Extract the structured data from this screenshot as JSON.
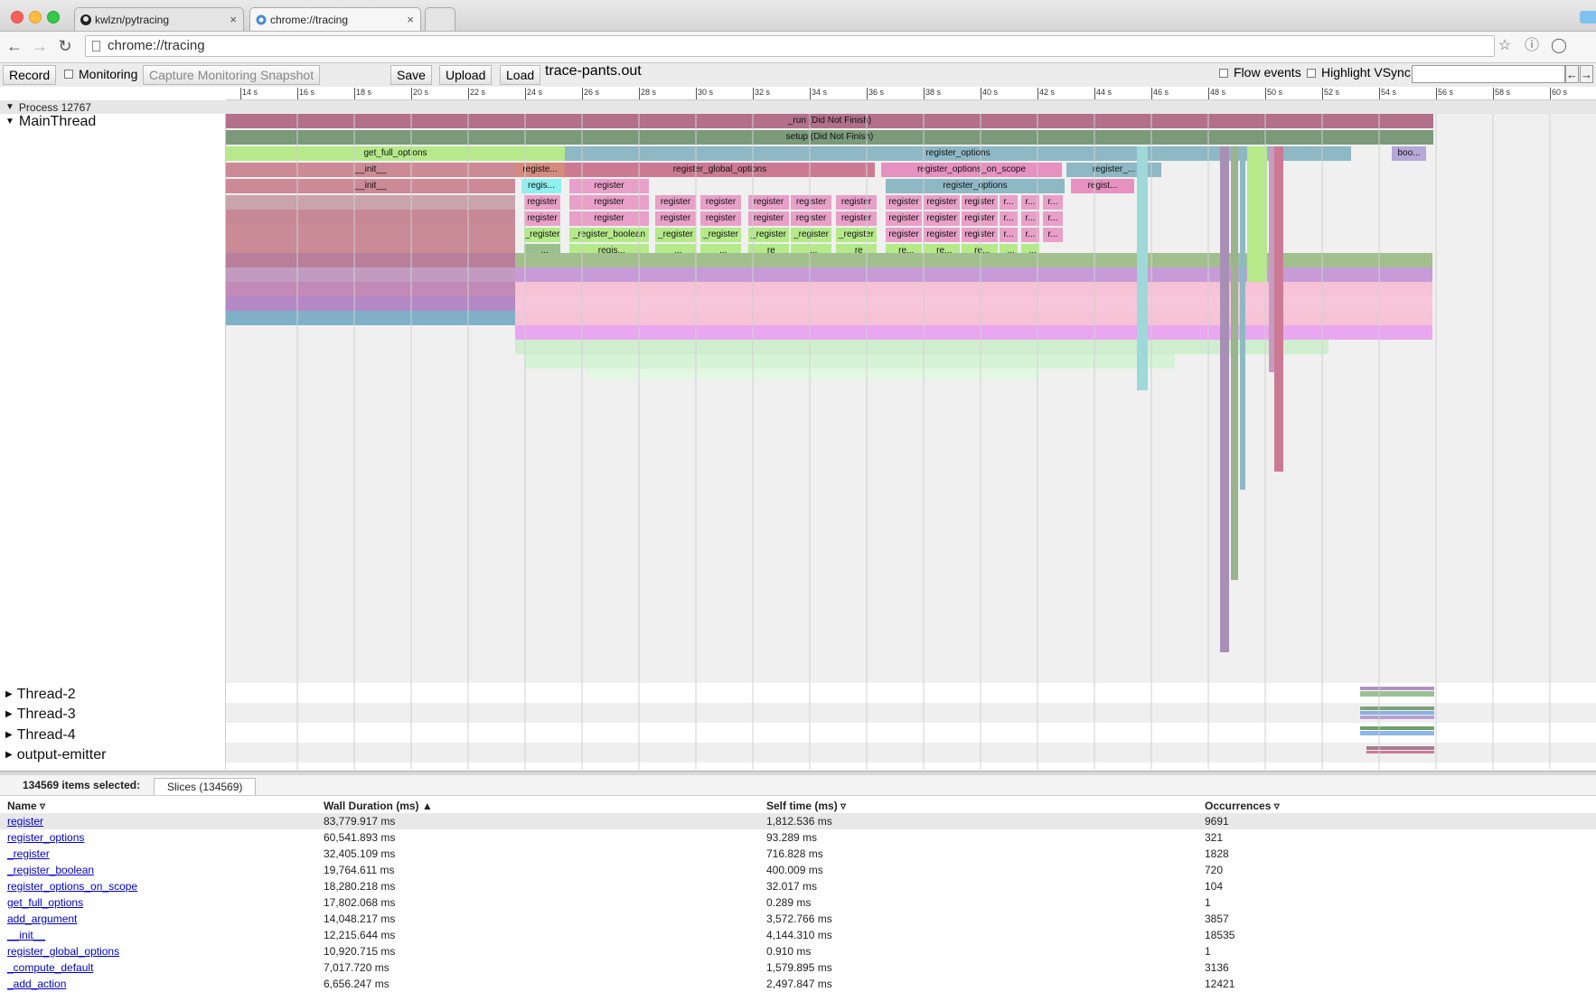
{
  "browser": {
    "tabs": [
      {
        "label": "kwlzn/pytracing",
        "active": false
      },
      {
        "label": "chrome://tracing",
        "active": true
      }
    ],
    "url": "chrome://tracing"
  },
  "toolbar": {
    "record_label": "Record",
    "monitoring_label": "Monitoring",
    "snapshot_label": "Capture Monitoring Snapshot",
    "save_label": "Save",
    "upload_label": "Upload",
    "load_label": "Load",
    "filename": "trace-pants.out",
    "flow_events_label": "Flow events",
    "highlight_vsync_label": "Highlight VSync",
    "prev_arrow": "←",
    "next_arrow": "→"
  },
  "ruler": {
    "ticks": [
      "14 s",
      "16 s",
      "18 s",
      "20 s",
      "22 s",
      "24 s",
      "26 s",
      "28 s",
      "30 s",
      "32 s",
      "34 s",
      "36 s",
      "38 s",
      "40 s",
      "42 s",
      "44 s",
      "46 s",
      "48 s",
      "50 s",
      "52 s",
      "54 s",
      "56 s",
      "58 s",
      "60 s"
    ]
  },
  "tracks": {
    "process_label": "Process 12767",
    "main_thread": "MainThread",
    "threads": [
      "Thread-2",
      "Thread-3",
      "Thread-4",
      "output-emitter"
    ]
  },
  "slices": {
    "run": "_run (Did Not Finish)",
    "setup": "setup (Did Not Finish)",
    "get_full_options": "get_full_options",
    "register_options": "register_options",
    "boo": "boo...",
    "init1": "__init__",
    "init2": "__init__",
    "registe": "registe...",
    "register_global_options": "register_global_options",
    "register_options_on_scope": "register_options_on_scope",
    "register_trunc": "register_...",
    "regis": "regis...",
    "register": "register",
    "register_options2": "register_options",
    "regist": "regist...",
    "r_trunc": "r...",
    "_register": "_register",
    "_register_boolean": "_register_boolean",
    "_regis": "_regis...",
    "_re": "_re",
    "_re_trunc": "_re...",
    "dots": "_..."
  },
  "tools": {
    "select": "select-tool",
    "pan": "pan-tool",
    "zoom": "zoom-tool",
    "timing": "timing-tool"
  },
  "panel": {
    "selected_text": "134569 items selected:",
    "tab_label": "Slices (134569)",
    "columns": {
      "name": "Name",
      "wall": "Wall Duration (ms) ▲",
      "self": "Self time (ms)",
      "occ": "Occurrences"
    },
    "rows": [
      {
        "name": "register",
        "wall": "83,779.917 ms",
        "self": "1,812.536 ms",
        "occ": "9691"
      },
      {
        "name": "register_options",
        "wall": "60,541.893 ms",
        "self": "93.289 ms",
        "occ": "321"
      },
      {
        "name": "_register",
        "wall": "32,405.109 ms",
        "self": "716.828 ms",
        "occ": "1828"
      },
      {
        "name": "_register_boolean",
        "wall": "19,764.611 ms",
        "self": "400.009 ms",
        "occ": "720"
      },
      {
        "name": "register_options_on_scope",
        "wall": "18,280.218 ms",
        "self": "32.017 ms",
        "occ": "104"
      },
      {
        "name": "get_full_options",
        "wall": "17,802.068 ms",
        "self": "0.289 ms",
        "occ": "1"
      },
      {
        "name": "add_argument",
        "wall": "14,048.217 ms",
        "self": "3,572.766 ms",
        "occ": "3857"
      },
      {
        "name": "__init__",
        "wall": "12,215.644 ms",
        "self": "4,144.310 ms",
        "occ": "18535"
      },
      {
        "name": "register_global_options",
        "wall": "10,920.715 ms",
        "self": "0.910 ms",
        "occ": "1"
      },
      {
        "name": "_compute_default",
        "wall": "7,017.720 ms",
        "self": "1,579.895 ms",
        "occ": "3136"
      },
      {
        "name": "_add_action",
        "wall": "6,656.247 ms",
        "self": "2,497.847 ms",
        "occ": "12421"
      }
    ]
  }
}
